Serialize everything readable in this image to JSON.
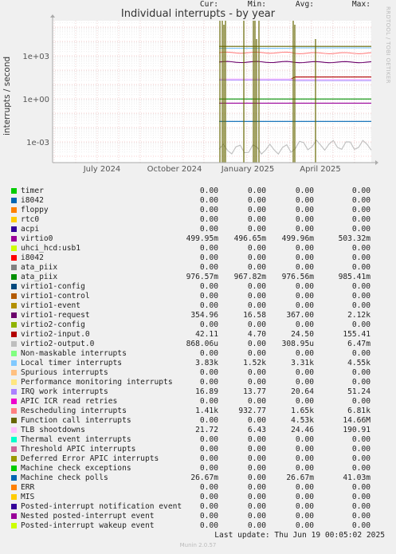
{
  "title": "Individual interrupts - by year",
  "side_text": "RRDTOOL / TOBI OETIKER",
  "footer": "Munin 2.0.57",
  "last_update": "Last update: Thu Jun 19 00:05:02 2025",
  "columns": [
    "Cur:",
    "Min:",
    "Avg:",
    "Max:"
  ],
  "chart_data": {
    "type": "line",
    "title": "Individual interrupts - by year",
    "ylabel": "interrupts / second",
    "yscale": "log",
    "ylim": [
      0.0001,
      1000000
    ],
    "yticks": [
      "1e+03",
      "1e+00",
      "1e-03"
    ],
    "xticks": [
      "July 2024",
      "October 2024",
      "January 2025",
      "April 2025"
    ],
    "grid": true,
    "series": [
      {
        "name": "timer",
        "color": "#00cc00",
        "cur": "0.00",
        "min": "0.00",
        "avg": "0.00",
        "max": "0.00"
      },
      {
        "name": "i8042",
        "color": "#0066b3",
        "cur": "0.00",
        "min": "0.00",
        "avg": "0.00",
        "max": "0.00"
      },
      {
        "name": "floppy",
        "color": "#ff8000",
        "cur": "0.00",
        "min": "0.00",
        "avg": "0.00",
        "max": "0.00"
      },
      {
        "name": "rtc0",
        "color": "#ffcc00",
        "cur": "0.00",
        "min": "0.00",
        "avg": "0.00",
        "max": "0.00"
      },
      {
        "name": "acpi",
        "color": "#330099",
        "cur": "0.00",
        "min": "0.00",
        "avg": "0.00",
        "max": "0.00"
      },
      {
        "name": "virtio0",
        "color": "#990099",
        "cur": "499.95m",
        "min": "496.65m",
        "avg": "499.96m",
        "max": "503.32m"
      },
      {
        "name": "uhci_hcd:usb1",
        "color": "#ccff00",
        "cur": "0.00",
        "min": "0.00",
        "avg": "0.00",
        "max": "0.00"
      },
      {
        "name": "i8042",
        "color": "#ff0000",
        "cur": "0.00",
        "min": "0.00",
        "avg": "0.00",
        "max": "0.00"
      },
      {
        "name": "ata_piix",
        "color": "#808080",
        "cur": "0.00",
        "min": "0.00",
        "avg": "0.00",
        "max": "0.00"
      },
      {
        "name": "ata_piix",
        "color": "#008f00",
        "cur": "976.57m",
        "min": "967.82m",
        "avg": "976.56m",
        "max": "985.41m"
      },
      {
        "name": "virtio1-config",
        "color": "#00487d",
        "cur": "0.00",
        "min": "0.00",
        "avg": "0.00",
        "max": "0.00"
      },
      {
        "name": "virtio1-control",
        "color": "#b35a00",
        "cur": "0.00",
        "min": "0.00",
        "avg": "0.00",
        "max": "0.00"
      },
      {
        "name": "virtio1-event",
        "color": "#b38f00",
        "cur": "0.00",
        "min": "0.00",
        "avg": "0.00",
        "max": "0.00"
      },
      {
        "name": "virtio1-request",
        "color": "#6b006b",
        "cur": "354.96",
        "min": "16.58",
        "avg": "367.00",
        "max": "2.12k"
      },
      {
        "name": "virtio2-config",
        "color": "#8fb300",
        "cur": "0.00",
        "min": "0.00",
        "avg": "0.00",
        "max": "0.00"
      },
      {
        "name": "virtio2-input.0",
        "color": "#b30000",
        "cur": "42.11",
        "min": "4.70",
        "avg": "24.50",
        "max": "155.41"
      },
      {
        "name": "virtio2-output.0",
        "color": "#bebebe",
        "cur": "868.06u",
        "min": "0.00",
        "avg": "308.95u",
        "max": "6.47m"
      },
      {
        "name": "Non-maskable interrupts",
        "color": "#80ff80",
        "cur": "0.00",
        "min": "0.00",
        "avg": "0.00",
        "max": "0.00"
      },
      {
        "name": "Local timer interrupts",
        "color": "#80c9ff",
        "cur": "3.83k",
        "min": "1.52k",
        "avg": "3.31k",
        "max": "4.55k"
      },
      {
        "name": "Spurious interrupts",
        "color": "#ffc080",
        "cur": "0.00",
        "min": "0.00",
        "avg": "0.00",
        "max": "0.00"
      },
      {
        "name": "Performance monitoring interrupts",
        "color": "#ffe680",
        "cur": "0.00",
        "min": "0.00",
        "avg": "0.00",
        "max": "0.00"
      },
      {
        "name": "IRQ work interrupts",
        "color": "#aa80ff",
        "cur": "16.89",
        "min": "13.77",
        "avg": "20.64",
        "max": "51.24"
      },
      {
        "name": "APIC ICR read retries",
        "color": "#ee00cc",
        "cur": "0.00",
        "min": "0.00",
        "avg": "0.00",
        "max": "0.00"
      },
      {
        "name": "Rescheduling interrupts",
        "color": "#ff8080",
        "cur": "1.41k",
        "min": "932.77",
        "avg": "1.65k",
        "max": "6.81k"
      },
      {
        "name": "Function call interrupts",
        "color": "#666600",
        "cur": "0.00",
        "min": "0.00",
        "avg": "4.53k",
        "max": "14.66M"
      },
      {
        "name": "TLB shootdowns",
        "color": "#ffbfff",
        "cur": "21.72",
        "min": "6.43",
        "avg": "24.46",
        "max": "190.91"
      },
      {
        "name": "Thermal event interrupts",
        "color": "#00ffcc",
        "cur": "0.00",
        "min": "0.00",
        "avg": "0.00",
        "max": "0.00"
      },
      {
        "name": "Threshold APIC interrupts",
        "color": "#cc6699",
        "cur": "0.00",
        "min": "0.00",
        "avg": "0.00",
        "max": "0.00"
      },
      {
        "name": "Deferred Error APIC interrupts",
        "color": "#999900",
        "cur": "0.00",
        "min": "0.00",
        "avg": "0.00",
        "max": "0.00"
      },
      {
        "name": "Machine check exceptions",
        "color": "#00cc00",
        "cur": "0.00",
        "min": "0.00",
        "avg": "0.00",
        "max": "0.00"
      },
      {
        "name": "Machine check polls",
        "color": "#0066b3",
        "cur": "26.67m",
        "min": "0.00",
        "avg": "26.67m",
        "max": "41.03m"
      },
      {
        "name": "ERR",
        "color": "#ff8000",
        "cur": "0.00",
        "min": "0.00",
        "avg": "0.00",
        "max": "0.00"
      },
      {
        "name": "MIS",
        "color": "#ffcc00",
        "cur": "0.00",
        "min": "0.00",
        "avg": "0.00",
        "max": "0.00"
      },
      {
        "name": "Posted-interrupt notification event",
        "color": "#330099",
        "cur": "0.00",
        "min": "0.00",
        "avg": "0.00",
        "max": "0.00"
      },
      {
        "name": "Nested posted-interrupt event",
        "color": "#990099",
        "cur": "0.00",
        "min": "0.00",
        "avg": "0.00",
        "max": "0.00"
      },
      {
        "name": "Posted-interrupt wakeup event",
        "color": "#ccff00",
        "cur": "0.00",
        "min": "0.00",
        "avg": "0.00",
        "max": "0.00"
      }
    ]
  }
}
